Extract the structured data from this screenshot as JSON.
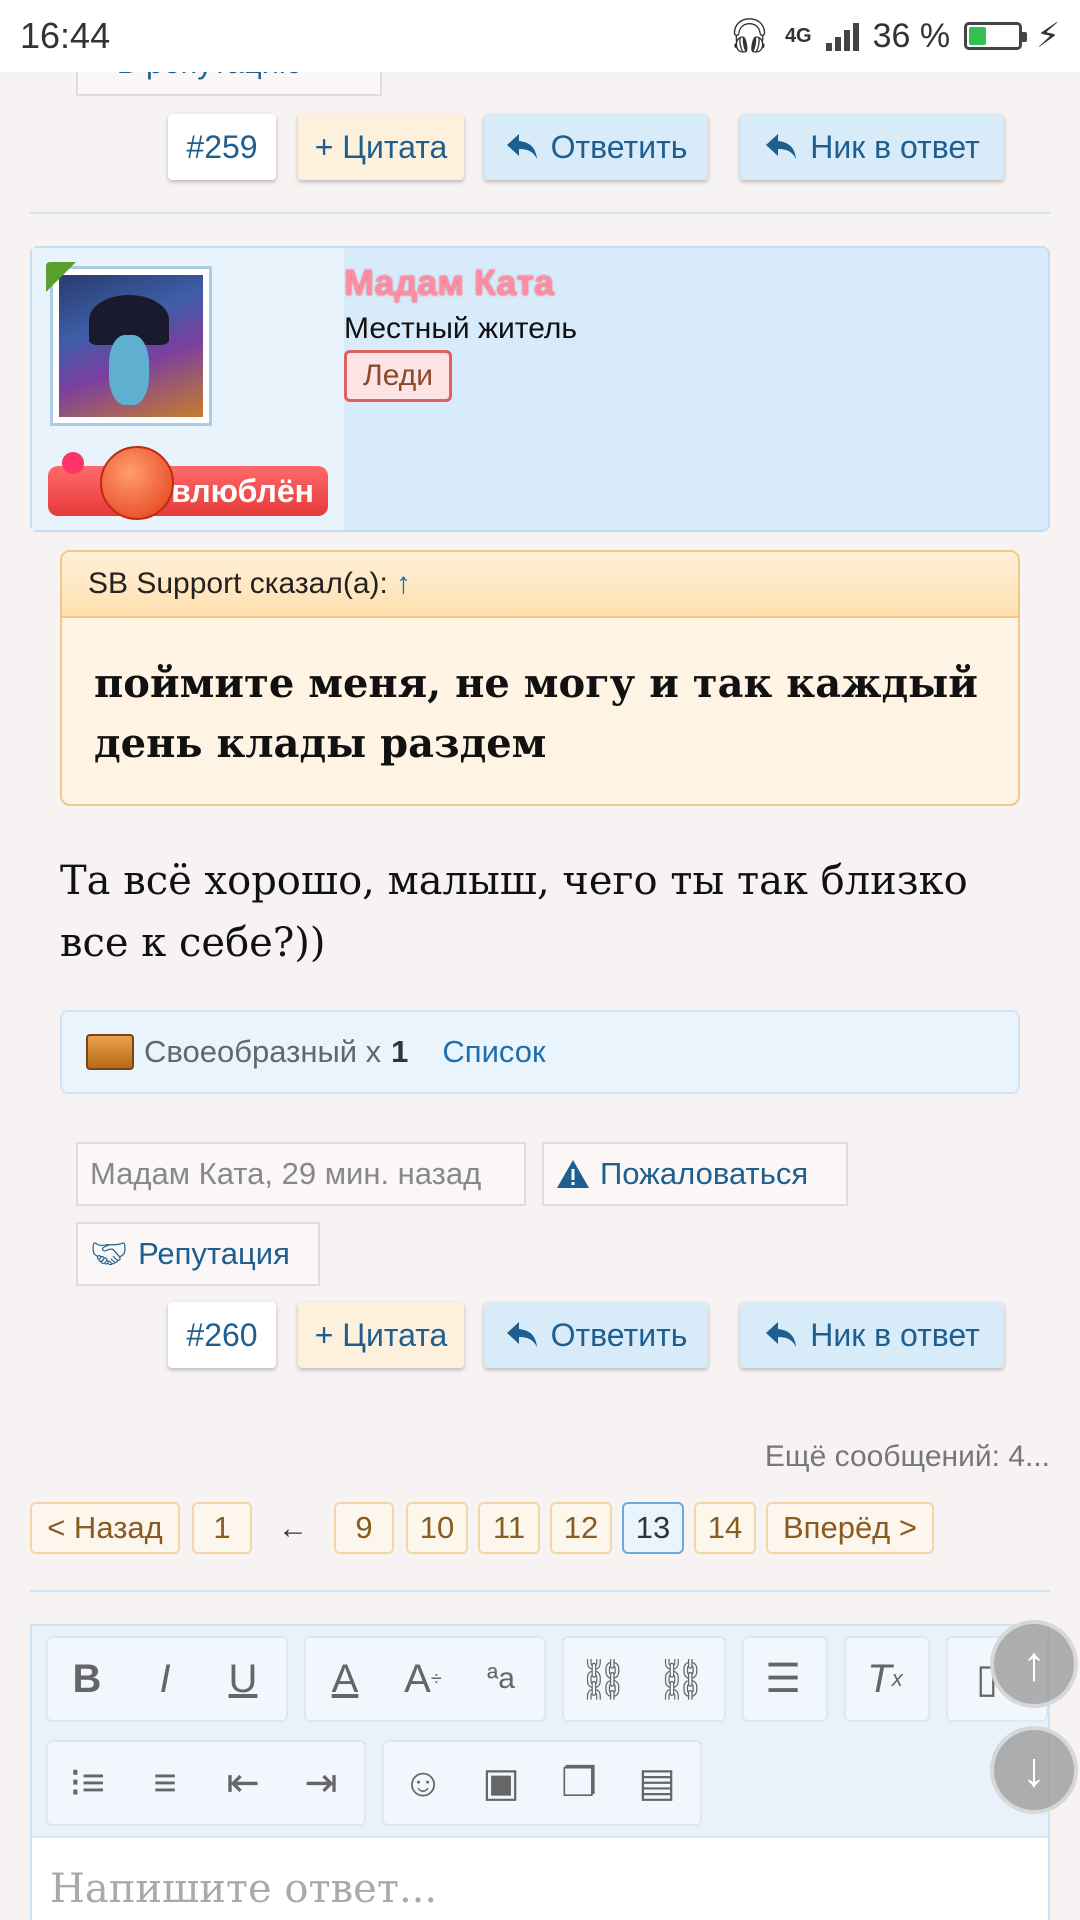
{
  "status_bar": {
    "time": "16:44",
    "network": "4G",
    "battery": "36 %",
    "battery_level": 0.36
  },
  "top_partial": {
    "reputation_label": "+ В репутацию"
  },
  "post_259": {
    "number": "#259",
    "quote": "+ Цитата",
    "reply": "Ответить",
    "nick_reply": "Ник в ответ"
  },
  "author": {
    "name": "Мадам Ката",
    "title": "Местный житель",
    "badge": "Леди",
    "mood": "влюблён"
  },
  "quote": {
    "author": "SB Support сказал(а):",
    "arrow": "↑",
    "text": "поймите меня, не могу и так каждый день клады раздем"
  },
  "post": {
    "text": "Та всё хорошо, малыш, чего ты так близко все к себе?))"
  },
  "likes": {
    "label": "Своеобразный x",
    "count": "1",
    "list": "Список"
  },
  "meta": {
    "author_time": "Мадам Ката, 29 мин. назад",
    "report": "Пожаловаться",
    "reputation": "Репутация"
  },
  "post_260": {
    "number": "#260",
    "quote": "+ Цитата",
    "reply": "Ответить",
    "nick_reply": "Ник в ответ"
  },
  "pagination": {
    "more": "Ещё сообщений: 4...",
    "prev": "< Назад",
    "first": "1",
    "gap": "←",
    "pages": [
      "9",
      "10",
      "11",
      "12",
      "13",
      "14"
    ],
    "current": "13",
    "next": "Вперёд >"
  },
  "editor": {
    "placeholder": "Напишите ответ..."
  }
}
